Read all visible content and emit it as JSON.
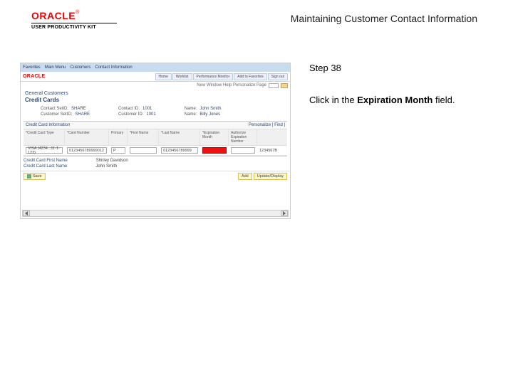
{
  "header": {
    "brand": "ORACLE",
    "tm": "®",
    "product": "USER PRODUCTIVITY KIT",
    "title": "Maintaining Customer Contact Information"
  },
  "instructions": {
    "step": "Step 38",
    "text_prefix": "Click in the ",
    "text_bold": "Expiration Month",
    "text_suffix": " field."
  },
  "screenshot": {
    "bluebar": {
      "b1": "Favorites",
      "b2": "Main Menu",
      "b3": "Customers",
      "b4": "Contact Information"
    },
    "logo": "ORACLE",
    "tabs": {
      "t1": "Home",
      "t2": "Worklist",
      "t3": "Performance Monitor",
      "t4": "Add to Favorites",
      "t5": "Sign out"
    },
    "subbar": {
      "label": "New Window  Help  Personalize Page"
    },
    "heading": "General Customers",
    "subheading": "Credit Cards",
    "info": {
      "r1lbl": "Contact SetID:",
      "r1val": "SHARE",
      "r1lbl2": "Contact ID:",
      "r1val2": "1001",
      "r1lbl3": "Name:",
      "r1val3": "John Smith",
      "r2lbl": "Customer SetID:",
      "r2val": "SHARE",
      "r2lbl2": "Customer ID:",
      "r2val2": "1001",
      "r2lbl3": "Name:",
      "r2val3": "Billy Jones"
    },
    "section_title": "Credit Card Information",
    "section_right": "Personalize | Find |",
    "thead": {
      "c1": "*Credit Card Type",
      "c2": "*Card Number",
      "c3": "Primary",
      "c4": "*First Name",
      "c5": "*Last Name",
      "c6": "*Expiration Month",
      "c7": "Authorize Expiration Number"
    },
    "row": {
      "type": "VISA (4234...11-1-123)",
      "num": "0123456789999012",
      "pri": "P",
      "name": "",
      "id": "0123456789999",
      "exp": "",
      "auth": "",
      "chk": "1234567B"
    },
    "meta": {
      "m1lbl": "Credit Card First Name",
      "m1val": "Shirley Davidson",
      "m2lbl": "Credit Card Last Name",
      "m2val": "John Smith"
    },
    "footer": {
      "save": "Save",
      "add": "Add",
      "update": "Update/Display"
    }
  }
}
